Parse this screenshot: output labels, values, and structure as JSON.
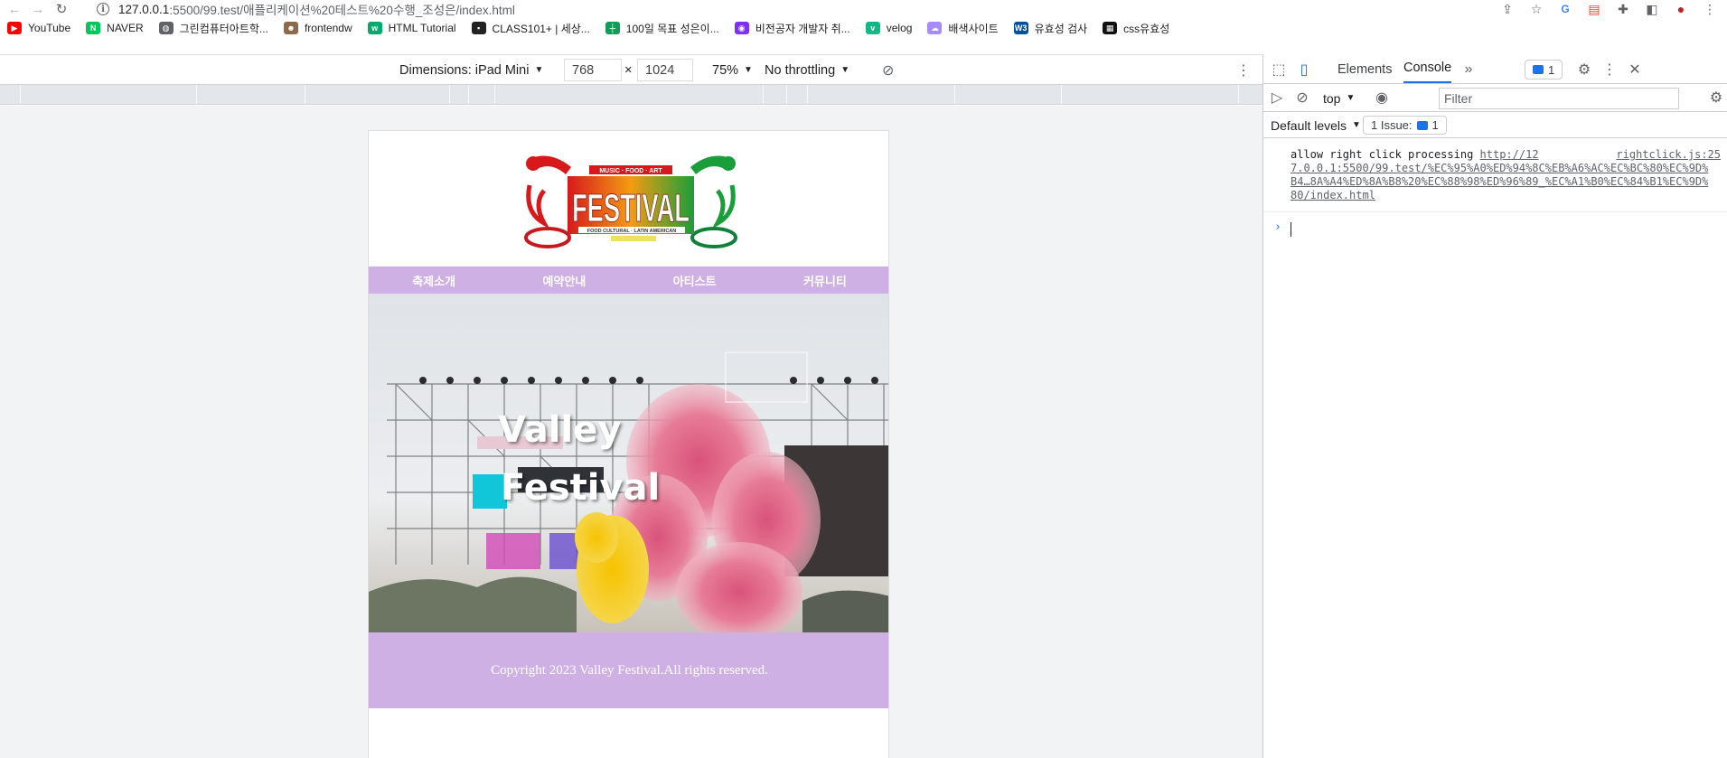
{
  "browser": {
    "url_host": "127.0.0.1",
    "url_path": ":5500/99.test/애플리케이션%20테스트%20수행_조성은/index.html",
    "bookmarks": [
      {
        "label": "YouTube",
        "color": "#ff0000",
        "glyph": "▶"
      },
      {
        "label": "NAVER",
        "color": "#03c75a",
        "glyph": "N"
      },
      {
        "label": "그린컴퓨터아트학...",
        "color": "#5f6368",
        "glyph": "◍"
      },
      {
        "label": "frontendw",
        "color": "#8a6a4a",
        "glyph": "☻"
      },
      {
        "label": "HTML Tutorial",
        "color": "#04aa6d",
        "glyph": "w"
      },
      {
        "label": "CLASS101+ | 세상...",
        "color": "#222222",
        "glyph": "▪"
      },
      {
        "label": "100일 목표 성은이...",
        "color": "#0f9d58",
        "glyph": "┼"
      },
      {
        "label": "비전공자 개발자 취...",
        "color": "#7b2ff7",
        "glyph": "◉"
      },
      {
        "label": "velog",
        "color": "#12b886",
        "glyph": "v"
      },
      {
        "label": "배색사이트",
        "color": "#a78bfa",
        "glyph": "☁"
      },
      {
        "label": "유효성 검사",
        "color": "#0050a0",
        "glyph": "W3"
      },
      {
        "label": "css유효성",
        "color": "#111111",
        "glyph": "▦"
      }
    ]
  },
  "device_toolbar": {
    "dimensions_label": "Dimensions: iPad Mini",
    "width": "768",
    "times": "×",
    "height": "1024",
    "zoom": "75%",
    "throttling": "No throttling"
  },
  "site": {
    "logo": {
      "title": "FESTIVAL",
      "top_text": "MUSIC · FOOD · ART",
      "bottom_text": "FOOD CULTURAL · LATIN AMERICAN",
      "colors": {
        "red": "#d7191c",
        "orange": "#f39c12",
        "green": "#1a9e3a"
      }
    },
    "nav": [
      "축제소개",
      "예약안내",
      "아티스트",
      "커뮤니티"
    ],
    "hero": {
      "line1": "Valley",
      "line2": "Festival"
    },
    "footer": "Copyright 2023 Valley Festival.All rights reserved."
  },
  "devtools": {
    "tabs": [
      "Elements",
      "Console"
    ],
    "active_tab": "Console",
    "issues_count": "1",
    "context": "top",
    "filter_placeholder": "Filter",
    "levels": "Default levels",
    "issues_label": "1 Issue:",
    "issues_badge": "1",
    "message": {
      "text": "allow right click processing",
      "link": "http://12",
      "source": "rightclick.js:25",
      "url_rest": "7.0.0.1:5500/99.test/%EC%95%A0%ED%94%8C%EB%A6%AC%EC%BC%80%EC%9D%B4…8A%A4%ED%8A%B8%20%EC%88%98%ED%96%89_%EC%A1%B0%EC%84%B1%EC%9D%80/index.html"
    },
    "prompt": "›"
  }
}
